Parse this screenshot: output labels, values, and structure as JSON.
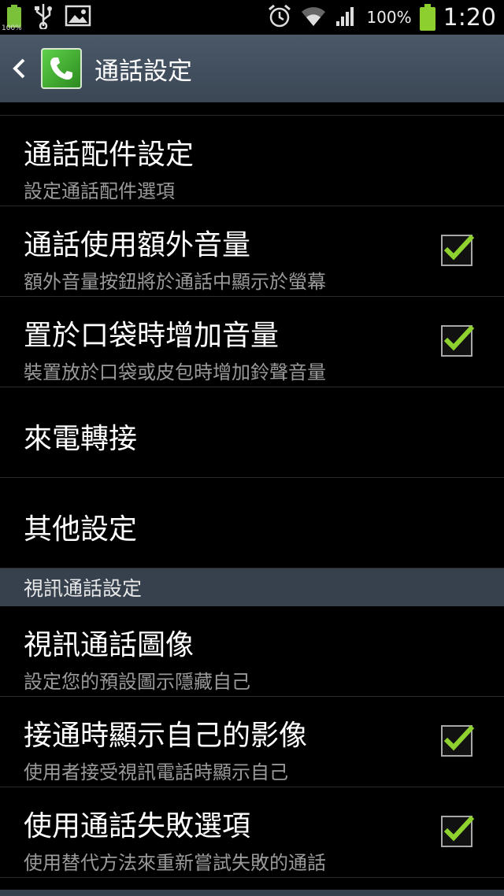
{
  "status_bar": {
    "mini_battery_text": "100%",
    "battery_pct": "100%",
    "time": "1:20",
    "icons": [
      "battery-icon",
      "usb-icon",
      "image-icon",
      "alarm-icon",
      "wifi-icon",
      "signal-icon",
      "battery-icon"
    ]
  },
  "action_bar": {
    "title": "通話設定",
    "back_icon": "chevron-left-icon",
    "app_icon": "phone-icon"
  },
  "items_general": [
    {
      "title": "通話配件設定",
      "summary": "設定通話配件選項",
      "checkbox": false
    },
    {
      "title": "通話使用額外音量",
      "summary": "額外音量按鈕將於通話中顯示於螢幕",
      "checkbox": true,
      "checked": true
    },
    {
      "title": "置於口袋時增加音量",
      "summary": "裝置放於口袋或皮包時增加鈴聲音量",
      "checkbox": true,
      "checked": true
    },
    {
      "title": "來電轉接",
      "summary": "",
      "checkbox": false
    },
    {
      "title": "其他設定",
      "summary": "",
      "checkbox": false
    }
  ],
  "section_video": {
    "header": "視訊通話設定"
  },
  "items_video": [
    {
      "title": "視訊通話圖像",
      "summary": "設定您的預設圖示隱藏自己",
      "checkbox": false
    },
    {
      "title": "接通時顯示自己的影像",
      "summary": "使用者接受視訊電話時顯示自己",
      "checkbox": true,
      "checked": true
    },
    {
      "title": "使用通話失敗選項",
      "summary": "使用替代方法來重新嘗試失敗的通話",
      "checkbox": true,
      "checked": true
    }
  ],
  "colors": {
    "accent_check": "#8fd12f",
    "header_bg": "#36414d",
    "actionbar_bg": "#3b4755"
  }
}
